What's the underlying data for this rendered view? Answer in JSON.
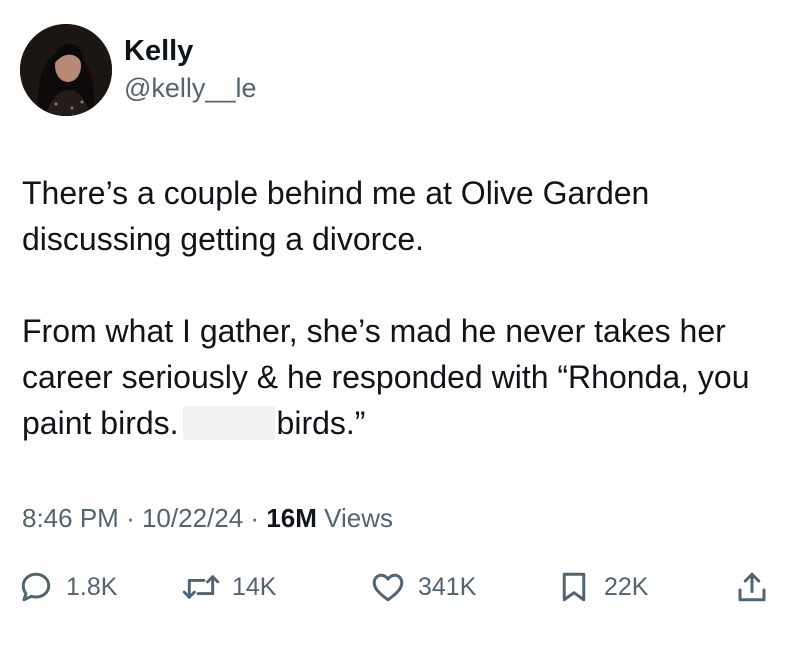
{
  "author": {
    "display_name": "Kelly",
    "handle": "@kelly__le",
    "avatar_icon": "profile-photo"
  },
  "tweet": {
    "paragraph1": "There’s a couple behind me at Olive Garden discussing getting a divorce.",
    "paragraph2_before": "From what I gather, she’s mad he never takes her career seriously & he responded with “Rhonda, you paint birds.",
    "paragraph2_after": "birds.”"
  },
  "meta": {
    "time": "8:46 PM",
    "separator": "·",
    "date": "10/22/24",
    "views_count": "16M",
    "views_label": "Views"
  },
  "actions": {
    "replies": "1.8K",
    "reposts": "14K",
    "likes": "341K",
    "bookmarks": "22K"
  },
  "colors": {
    "text": "#0f1419",
    "secondary": "#536471",
    "background": "#ffffff"
  }
}
